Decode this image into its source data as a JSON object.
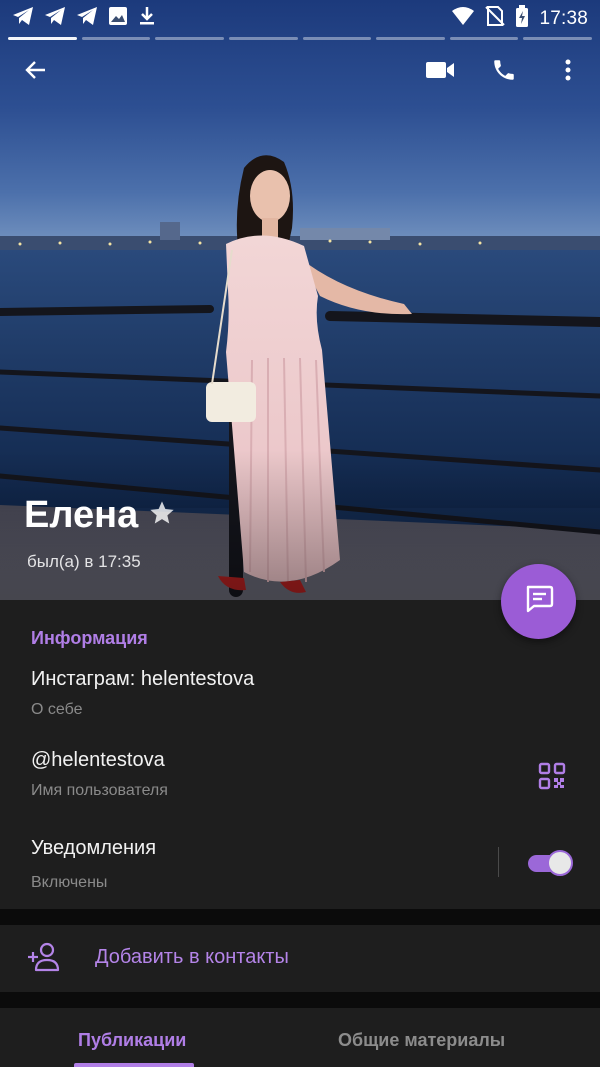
{
  "status_bar": {
    "time": "17:38",
    "left_icons": [
      "telegram-icon",
      "telegram-icon",
      "telegram-icon",
      "image-icon",
      "download-icon"
    ],
    "right_icons": [
      "wifi-icon",
      "no-sim-icon",
      "battery-icon"
    ]
  },
  "stories": {
    "count": 8,
    "active_index": 0
  },
  "action_bar": {
    "back_icon": "back-arrow-icon",
    "video_icon": "video-call-icon",
    "call_icon": "phone-icon",
    "menu_icon": "more-vertical-icon"
  },
  "profile": {
    "name": "Елена",
    "last_seen": "был(а) в 17:35"
  },
  "info": {
    "section_title": "Информация",
    "bio": "Инстаграм: helentestova",
    "bio_label": "О себе",
    "username": "@helentestova",
    "username_label": "Имя пользователя",
    "notifications": "Уведомления",
    "notifications_state": "Включены",
    "notifications_enabled": true
  },
  "actions": {
    "add_contact": "Добавить в контакты"
  },
  "tabs": [
    {
      "label": "Публикации",
      "active": true
    },
    {
      "label": "Общие материалы",
      "active": false
    }
  ],
  "colors": {
    "accent": "#b07ee6",
    "fab": "#9b5cd6",
    "card_bg": "#1e1e1e",
    "page_bg": "#0b0b0b"
  }
}
